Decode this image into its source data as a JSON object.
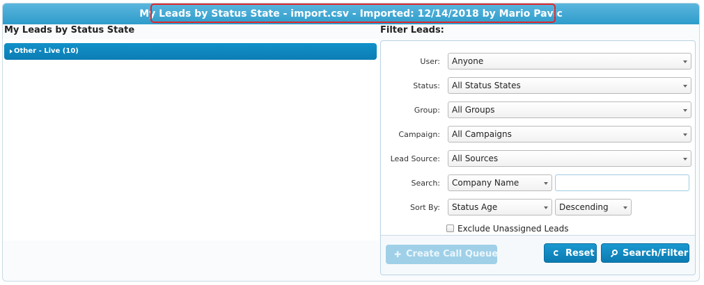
{
  "title_bar": {
    "title": "My Leads by Status State - import.csv - Imported: 12/14/2018 by Mario Pavic"
  },
  "left_panel": {
    "header": "My Leads by Status State",
    "groups": [
      {
        "label": "Other - Live (10)",
        "icon": "caret-right-icon"
      }
    ]
  },
  "filter": {
    "header": "Filter Leads:",
    "user": {
      "label": "User:",
      "value": "Anyone"
    },
    "status": {
      "label": "Status:",
      "value": "All Status States"
    },
    "group": {
      "label": "Group:",
      "value": "All Groups"
    },
    "campaign": {
      "label": "Campaign:",
      "value": "All Campaigns"
    },
    "lead_source": {
      "label": "Lead Source:",
      "value": "All Sources"
    },
    "search": {
      "label": "Search:",
      "field_value": "Company Name",
      "text_value": ""
    },
    "sort": {
      "label": "Sort By:",
      "field_value": "Status Age",
      "order_value": "Descending"
    },
    "exclude_unassigned": {
      "label": "Exclude Unassigned Leads",
      "checked": false
    }
  },
  "buttons": {
    "create_call_queue": {
      "label": "Create Call Queue",
      "icon": "plus-icon",
      "icon_glyph": "✚",
      "enabled": false
    },
    "reset": {
      "label": "Reset",
      "icon": "refresh-icon"
    },
    "search_filter": {
      "label": "Search/Filter",
      "icon": "search-icon"
    }
  },
  "colors": {
    "title_bar": "#2e9ccb",
    "highlight": "#e0262b",
    "primary_button": "#0b7bb2",
    "group_row": "#0b7db4"
  }
}
